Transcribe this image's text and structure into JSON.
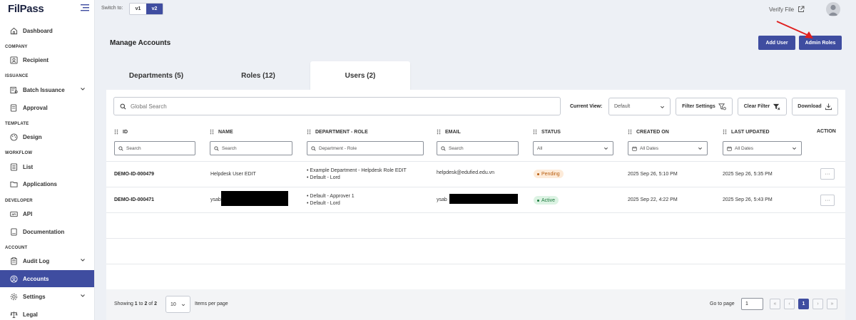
{
  "app": {
    "logo": "FilPass"
  },
  "sidebar": {
    "items": [
      {
        "label": "Dashboard",
        "icon": "home-icon",
        "section": ""
      },
      {
        "label": "Recipient",
        "icon": "contact-icon",
        "section": "COMPANY"
      },
      {
        "label": "Batch Issuance",
        "icon": "certificate-icon",
        "section": "ISSUANCE",
        "expandable": true
      },
      {
        "label": "Approval",
        "icon": "approval-icon",
        "section": ""
      },
      {
        "label": "Design",
        "icon": "palette-icon",
        "section": "TEMPLATE"
      },
      {
        "label": "List",
        "icon": "list-icon",
        "section": "WORKFLOW"
      },
      {
        "label": "Applications",
        "icon": "folder-icon",
        "section": ""
      },
      {
        "label": "API",
        "icon": "api-icon",
        "section": "DEVELOPER"
      },
      {
        "label": "Documentation",
        "icon": "document-icon",
        "section": ""
      },
      {
        "label": "Audit Log",
        "icon": "audit-icon",
        "section": "ACCOUNT",
        "expandable": true
      },
      {
        "label": "Accounts",
        "icon": "user-circle-icon",
        "section": "",
        "active": true
      },
      {
        "label": "Settings",
        "icon": "gear-icon",
        "section": "",
        "expandable": true
      },
      {
        "label": "Legal",
        "icon": "scale-icon",
        "section": ""
      }
    ],
    "sections": [
      "COMPANY",
      "ISSUANCE",
      "TEMPLATE",
      "WORKFLOW",
      "DEVELOPER",
      "ACCOUNT"
    ]
  },
  "topbar": {
    "switch_label": "Switch to:",
    "versions": [
      "v1",
      "v2"
    ],
    "active_version": "v2",
    "verify_file": "Verify File"
  },
  "page": {
    "title": "Manage Accounts",
    "add_user": "Add User",
    "admin_roles": "Admin Roles"
  },
  "tabs": [
    {
      "label": "Departments (5)",
      "active": false
    },
    {
      "label": "Roles (12)",
      "active": false
    },
    {
      "label": "Users (2)",
      "active": true
    }
  ],
  "toolbar": {
    "global_search_placeholder": "Global Search",
    "current_view_label": "Current View:",
    "current_view_value": "Default",
    "filter_settings": "Filter Settings",
    "clear_filter": "Clear Filter",
    "download": "Download"
  },
  "table": {
    "columns": [
      "ID",
      "NAME",
      "DEPARTMENT - ROLE",
      "EMAIL",
      "STATUS",
      "CREATED ON",
      "LAST UPDATED",
      "ACTION"
    ],
    "filters": {
      "id": "Search",
      "name": "Search",
      "department_role": "Department - Role",
      "email": "Search",
      "status": "All",
      "created_on": "All Dates",
      "last_updated": "All Dates"
    },
    "rows": [
      {
        "id": "DEMO-ID-000479",
        "name": "Helpdesk User EDIT",
        "roles": [
          "• Example Department - Helpdesk Role EDIT",
          "• Default - Lord"
        ],
        "email": "helpdesk@edufied.edu.vn",
        "status": "Pending",
        "created_on": "2025 Sep 26, 5:10 PM",
        "last_updated": "2025 Sep 26, 5:35 PM",
        "action": "···"
      },
      {
        "id": "DEMO-ID-000471",
        "name": "ysab",
        "roles": [
          "• Default - Approver 1",
          "• Default - Lord"
        ],
        "email": "ysab",
        "status": "Active",
        "created_on": "2025 Sep 22, 4:22 PM",
        "last_updated": "2025 Sep 26, 5:43 PM",
        "action": "···"
      }
    ]
  },
  "pagination": {
    "showing_prefix": "Showing ",
    "from": "1",
    "to_word": " to ",
    "to": "2",
    "of_word": " of ",
    "total": "2",
    "per_page": "10",
    "items_per_page": "Items per page",
    "go_to_page": "Go to page",
    "goto_value": "1",
    "first": "«",
    "prev": "‹",
    "current": "1",
    "next": "›",
    "last": "»"
  },
  "colors": {
    "primary": "#3f4da0",
    "arrow": "#e02020",
    "pending_bg": "#fdebd9",
    "active_bg": "#dcf3e3"
  }
}
